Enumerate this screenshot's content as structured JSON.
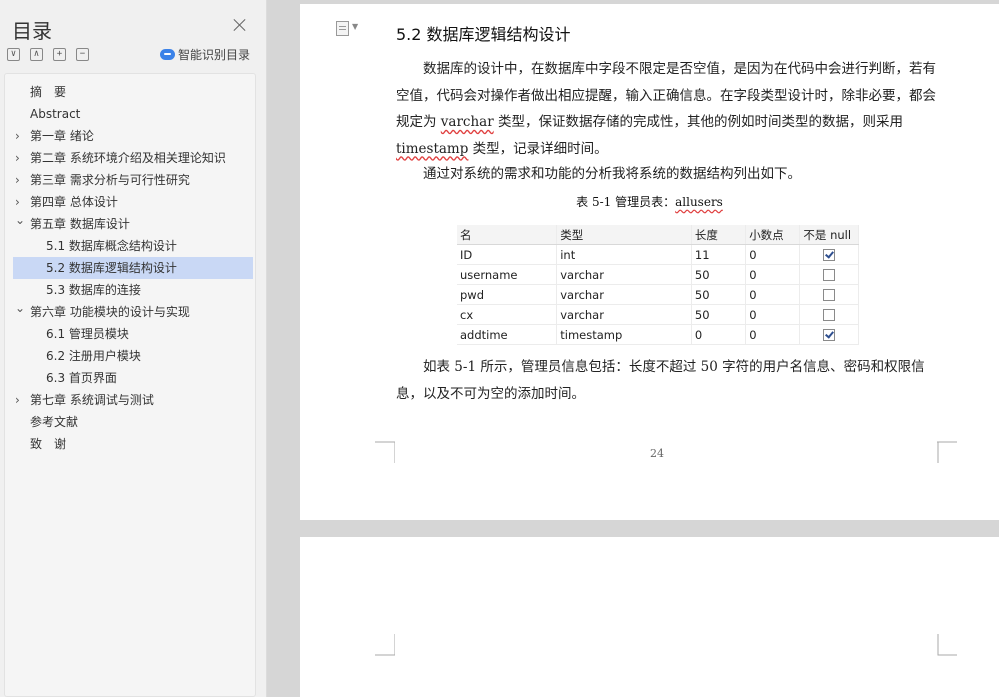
{
  "sidebar": {
    "title": "目录",
    "smart_label": "智能识别目录",
    "tools": [
      "∨",
      "∧",
      "+",
      "−"
    ],
    "toc": [
      {
        "label": "摘　要",
        "level": 0,
        "chevron": ""
      },
      {
        "label": "Abstract",
        "level": 0,
        "chevron": ""
      },
      {
        "label": "第一章 绪论",
        "level": 0,
        "chevron": "right"
      },
      {
        "label": "第二章 系统环境介绍及相关理论知识",
        "level": 0,
        "chevron": "right"
      },
      {
        "label": "第三章 需求分析与可行性研究",
        "level": 0,
        "chevron": "right"
      },
      {
        "label": "第四章 总体设计",
        "level": 0,
        "chevron": "right"
      },
      {
        "label": "第五章 数据库设计",
        "level": 0,
        "chevron": "down"
      },
      {
        "label": "5.1 数据库概念结构设计",
        "level": 1,
        "chevron": ""
      },
      {
        "label": "5.2 数据库逻辑结构设计",
        "level": 1,
        "chevron": "",
        "selected": true
      },
      {
        "label": "5.3 数据库的连接",
        "level": 1,
        "chevron": ""
      },
      {
        "label": "第六章 功能模块的设计与实现",
        "level": 0,
        "chevron": "down"
      },
      {
        "label": "6.1 管理员模块",
        "level": 1,
        "chevron": ""
      },
      {
        "label": "6.2 注册用户模块",
        "level": 1,
        "chevron": ""
      },
      {
        "label": "6.3 首页界面",
        "level": 1,
        "chevron": ""
      },
      {
        "label": "第七章 系统调试与测试",
        "level": 0,
        "chevron": "right"
      },
      {
        "label": "参考文献",
        "level": 0,
        "chevron": ""
      },
      {
        "label": "致　谢",
        "level": 0,
        "chevron": ""
      }
    ]
  },
  "doc": {
    "heading": "5.2  数据库逻辑结构设计",
    "p1_a": "数据库的设计中，在数据库中字段不限定是否空值，是因为在代码中会进行判断，若有空值，代码会对操作者做出相应提醒，输入正确信息。在字段类型设计时，除非必要，都会规定为 ",
    "p1_w1": "varchar",
    "p1_b": " 类型，保证数据存储的完成性，其他的例如时间类型的数据，则采用 ",
    "p1_w2": "timestamp",
    "p1_c": " 类型，记录详细时间。",
    "p2": "通过对系统的需求和功能的分析我将系统的数据结构列出如下。",
    "caption_prefix": "表 5-1   管理员表：",
    "caption_name": "allusers",
    "table": {
      "headers": [
        "名",
        "类型",
        "长度",
        "小数点",
        "不是 null"
      ],
      "rows": [
        {
          "name": "ID",
          "type": "int",
          "length": "11",
          "decimal": "0",
          "notnull": true
        },
        {
          "name": "username",
          "type": "varchar",
          "length": "50",
          "decimal": "0",
          "notnull": false
        },
        {
          "name": "pwd",
          "type": "varchar",
          "length": "50",
          "decimal": "0",
          "notnull": false
        },
        {
          "name": "cx",
          "type": "varchar",
          "length": "50",
          "decimal": "0",
          "notnull": false
        },
        {
          "name": "addtime",
          "type": "timestamp",
          "length": "0",
          "decimal": "0",
          "notnull": true
        }
      ]
    },
    "p3": "如表 5-1 所示，管理员信息包括：长度不超过 50 字符的用户名信息、密码和权限信息，以及不可为空的添加时间。",
    "page_number": "24"
  },
  "colors": {
    "selected_row": "#c9d8f5",
    "accent": "#3b82e8"
  }
}
